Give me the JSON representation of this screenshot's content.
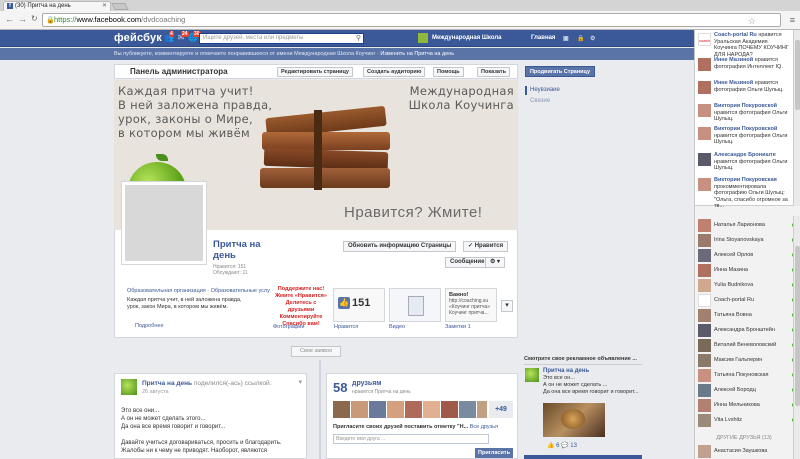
{
  "browser": {
    "tab_title": "(30) Притча на день",
    "url_scheme": "https://",
    "url_host": "www.facebook.com",
    "url_path": "/dvdcoaching"
  },
  "fb": {
    "logo": "фейсбук",
    "badges": {
      "friends": "4",
      "messages": "24",
      "notifications": "30"
    },
    "search_placeholder": "Ищите друзей, места или предметы",
    "page_name_top": "Международная Школа",
    "home": "Главная"
  },
  "notice": {
    "text": "Вы публикуете, комментируете и отмечаете понравившееся от имени Международная Школа Коучинг · ",
    "link": "Изменить на Притча на день"
  },
  "admin": {
    "title": "Панель администратора",
    "buttons": [
      "Редактировать страницу",
      "Создать аудиторию",
      "Помощь",
      "Показать"
    ]
  },
  "cover": {
    "left_text": [
      "Каждая притча учит!",
      "В ней заложена правда,",
      "урок, законы о Мире,",
      "в котором мы живём"
    ],
    "right_text": [
      "Международная",
      "Школа Коучинга"
    ],
    "cta": "Нравится? Жмите!"
  },
  "page": {
    "name": "Притча на день",
    "likes_line": "Нравится: 151",
    "talking_line": "Обсуждают: 11",
    "btn_update": "Обновить информацию Страницы",
    "btn_liked": "Нравится",
    "btn_message": "Сообщение",
    "category": "Образовательная организация · Образовательные услу",
    "about": "Каждая притча учит, в ней заложена правда, урок, закон Мира, в котором мы живём.",
    "more": "Подробнее",
    "support": "Поддержите нас! Жмите «Нравится» Делитесь с друзьями Комментируйте Спасибо вам!",
    "likes_count": "151",
    "important_title": "Важно!",
    "important_text": "http://coaching.su «Коучинг притча» Коучинг притча...",
    "tab_labels": [
      "Фотографии",
      "Нравится",
      "Видео",
      "Заметки 1"
    ]
  },
  "side": {
    "promote": "Продвигать Страницу",
    "new": "Неувзиаие",
    "saved": "Связие"
  },
  "timeline": {
    "year_btn": "Свое заявоо"
  },
  "post": {
    "author": "Притча на день",
    "action": "поделился(-ась) ссылкой.",
    "date": "26 августа",
    "lines": [
      "Это все они...",
      "А он не может сделать этого...",
      "Да она все время говорит и говорит...",
      "",
      "Давайте учиться договариваться, просить и благодарить.",
      "Жалобы ни к чему не приводят. Наоборот, являются"
    ]
  },
  "friends": {
    "count": "58",
    "label": "друзьям",
    "sub": "нравится Притча на день",
    "more": "+49",
    "invite": "Пригласите своих друзей поставить отметку \"Н...",
    "invite_all": "Все друзья",
    "input_placeholder": "Введите имя друга ...",
    "invite_btn": "Пригласить"
  },
  "ad": {
    "header": "Смотрите свое рекламное объявление ...",
    "title": "Притча на день",
    "desc": [
      "Это все он...",
      "А он не может сделать ...",
      "Да она все время говорит и говорит..."
    ],
    "likes": "6",
    "comments": "13"
  },
  "ticker": [
    {
      "name": "Coach-portal Ru",
      "text": "нравится Уральская Академия Коучинга ПОЧЕМУ КОУЧИНГ ДЛЯ НАРОДА?"
    },
    {
      "name": "Инне Мазиной",
      "text": "нравится фотография Интеллект IQ."
    },
    {
      "name": "Инне Мазиной",
      "text": "нравится фотография Ольги Шулыц."
    },
    {
      "name": "Виктория Покуровской",
      "text": "нравится фотография Ольги Шулыц."
    },
    {
      "name": "Виктории Покуровской",
      "text": "нравится фотография Ольги Шулыц."
    },
    {
      "name": "Александре Брониште",
      "text": "нравится фотография Ольги Шулыц."
    },
    {
      "name": "Виктории Покуровская",
      "text": "прокомментировала фотографию Ольги Шулыц: \"Ольга, спасибо огромное за тв..."
    }
  ],
  "chat": [
    "Наталья Ларионова",
    "Irina Stoyanovskaya",
    "Алексей Орлов",
    "Инна Мазина",
    "Yulia Budnikova",
    "Coach-portal Ru",
    "Татьяна Вовна",
    "Александра Бронштейн",
    "Виталий Веневоловский",
    "Максим Гальперин",
    "Татьяна Покуновская",
    "Алексей Бородц",
    "Инна Мельникова",
    "Vita Lvshitz"
  ],
  "other_friends": "ДРУГИЕ ДРУЗЬЯ (13)",
  "last_friend": "Анастасия Заушкова"
}
